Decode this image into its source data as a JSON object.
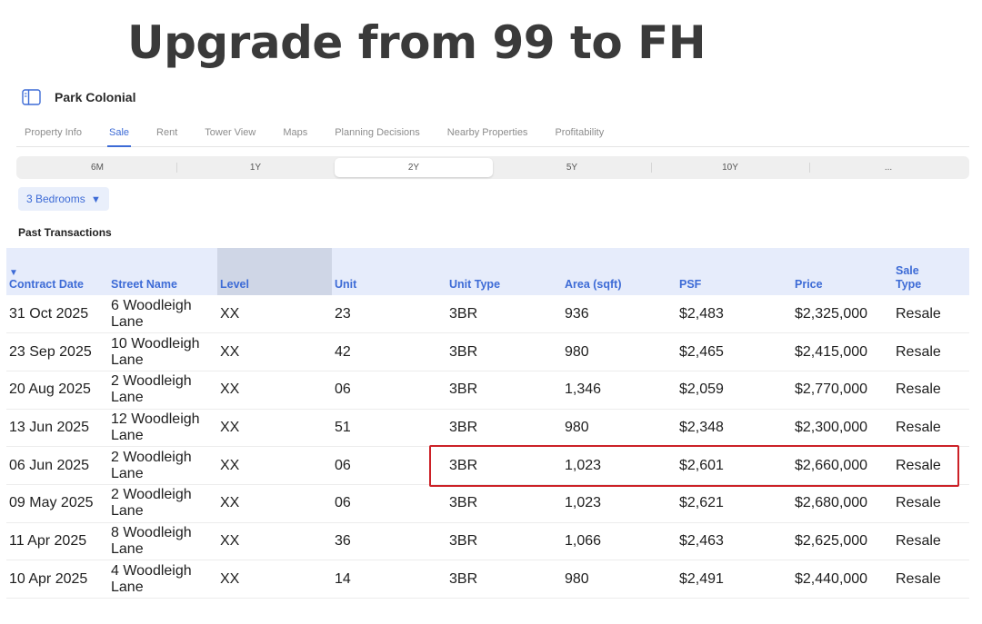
{
  "headline": "Upgrade from 99 to FH",
  "app": {
    "title": "Park Colonial",
    "icon": "sidebar-toggle-icon"
  },
  "tabs": [
    {
      "label": "Property Info",
      "active": false
    },
    {
      "label": "Sale",
      "active": true
    },
    {
      "label": "Rent",
      "active": false
    },
    {
      "label": "Tower View",
      "active": false
    },
    {
      "label": "Maps",
      "active": false
    },
    {
      "label": "Planning Decisions",
      "active": false
    },
    {
      "label": "Nearby Properties",
      "active": false
    },
    {
      "label": "Profitability",
      "active": false
    }
  ],
  "periods": [
    {
      "label": "6M",
      "active": false
    },
    {
      "label": "1Y",
      "active": false
    },
    {
      "label": "2Y",
      "active": true
    },
    {
      "label": "5Y",
      "active": false
    },
    {
      "label": "10Y",
      "active": false
    },
    {
      "label": "...",
      "active": false
    }
  ],
  "filter": {
    "bedrooms": "3 Bedrooms",
    "caret": "▼"
  },
  "section_title": "Past Transactions",
  "table": {
    "sort_indicator": "▼",
    "columns": [
      "Contract Date",
      "Street Name",
      "Level",
      "Unit",
      "Unit Type",
      "Area (sqft)",
      "PSF",
      "Price",
      "Sale Type"
    ],
    "rows": [
      [
        "31 Oct 2025",
        "6 Woodleigh Lane",
        "XX",
        "23",
        "3BR",
        "936",
        "$2,483",
        "$2,325,000",
        "Resale"
      ],
      [
        "23 Sep 2025",
        "10 Woodleigh Lane",
        "XX",
        "42",
        "3BR",
        "980",
        "$2,465",
        "$2,415,000",
        "Resale"
      ],
      [
        "20 Aug 2025",
        "2 Woodleigh Lane",
        "XX",
        "06",
        "3BR",
        "1,346",
        "$2,059",
        "$2,770,000",
        "Resale"
      ],
      [
        "13 Jun 2025",
        "12 Woodleigh Lane",
        "XX",
        "51",
        "3BR",
        "980",
        "$2,348",
        "$2,300,000",
        "Resale"
      ],
      [
        "06 Jun 2025",
        "2 Woodleigh Lane",
        "XX",
        "06",
        "3BR",
        "1,023",
        "$2,601",
        "$2,660,000",
        "Resale"
      ],
      [
        "09 May 2025",
        "2 Woodleigh Lane",
        "XX",
        "06",
        "3BR",
        "1,023",
        "$2,621",
        "$2,680,000",
        "Resale"
      ],
      [
        "11 Apr 2025",
        "8 Woodleigh Lane",
        "XX",
        "36",
        "3BR",
        "1,066",
        "$2,463",
        "$2,625,000",
        "Resale"
      ],
      [
        "10 Apr 2025",
        "4 Woodleigh Lane",
        "XX",
        "14",
        "3BR",
        "980",
        "$2,491",
        "$2,440,000",
        "Resale"
      ]
    ]
  },
  "colors": {
    "accent": "#3d6bd6",
    "header_bg": "#e6ecfb",
    "highlight": "#cc2127"
  }
}
